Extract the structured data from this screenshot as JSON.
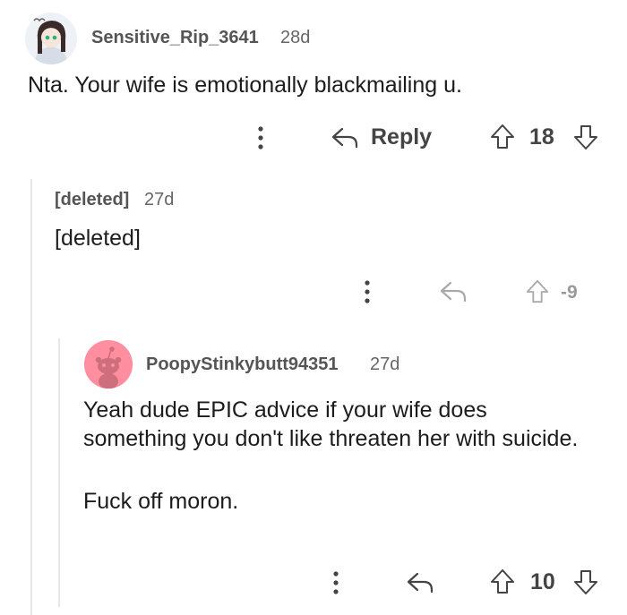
{
  "comments": [
    {
      "username": "Sensitive_Rip_3641",
      "age": "28d",
      "body": [
        "Nta. Your wife is emotionally blackmailing u."
      ],
      "reply_label": "Reply",
      "score": "18"
    },
    {
      "username": "[deleted]",
      "age": "27d",
      "body": [
        "[deleted]"
      ],
      "score": "-9"
    },
    {
      "username": "PoopyStinkybutt94351",
      "age": "27d",
      "body": [
        "Yeah dude EPIC advice if your wife does something you don't like threaten her with suicide.",
        "Fuck off moron."
      ],
      "score": "10"
    }
  ],
  "colors": {
    "thread_line": "#e6e6e6",
    "snoo_bg": "#ff8fa0"
  },
  "icons": [
    "more-options-icon",
    "reply-arrow-icon",
    "upvote-icon",
    "downvote-icon",
    "avatar-icon"
  ]
}
